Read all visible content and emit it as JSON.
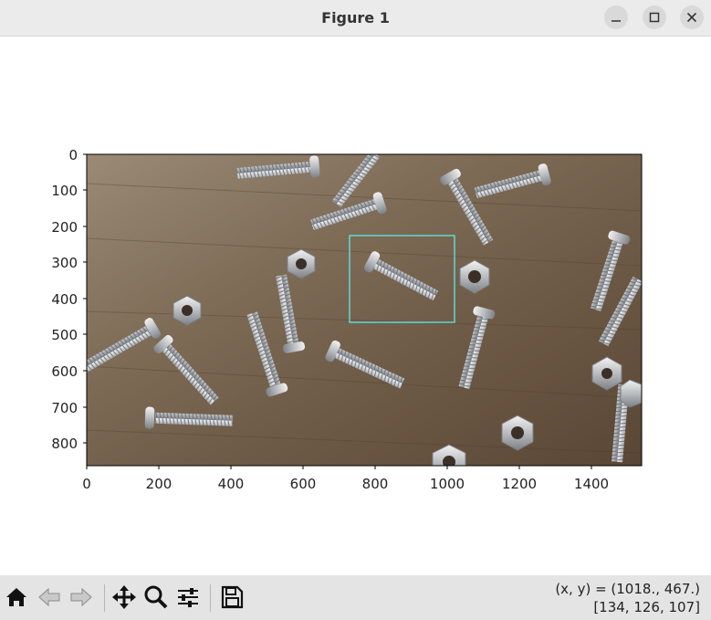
{
  "window": {
    "title": "Figure 1"
  },
  "window_controls": {
    "minimize_icon": "minimize-icon",
    "maximize_icon": "maximize-icon",
    "close_icon": "close-icon"
  },
  "plot": {
    "image_description_icon": "photo-of-screws-and-nuts",
    "x_ticks": [
      "0",
      "200",
      "400",
      "600",
      "800",
      "1000",
      "1200",
      "1400"
    ],
    "y_ticks": [
      "0",
      "100",
      "200",
      "300",
      "400",
      "500",
      "600",
      "700",
      "800"
    ],
    "highlight_color": "#5fe0dc"
  },
  "toolbar": {
    "buttons": [
      "home-icon",
      "back-arrow-icon",
      "forward-arrow-icon",
      "pan-icon",
      "zoom-icon",
      "configure-subplots-icon",
      "save-icon"
    ]
  },
  "status": {
    "coords": "(x, y) = (1018., 467.)",
    "pixel": "[134, 126, 107]"
  }
}
